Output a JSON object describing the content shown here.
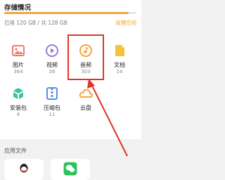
{
  "storage": {
    "title": "存储情况",
    "used_text": "已用 120 GB / 共 128 GB",
    "clean_label": "清理空间",
    "used_fraction": 0.94,
    "accent_color": "#f3a63b"
  },
  "categories": [
    {
      "label": "图片",
      "count": "364",
      "icon": "image-icon",
      "color": "#f07a6a"
    },
    {
      "label": "视频",
      "count": "36",
      "icon": "video-play-icon",
      "color": "#9b7bd8"
    },
    {
      "label": "音频",
      "count": "303",
      "icon": "music-icon",
      "color": "#f3a63b"
    },
    {
      "label": "文档",
      "count": "14",
      "icon": "document-icon",
      "color": "#f5c23e"
    },
    {
      "label": "安装包",
      "count": "4",
      "icon": "package-icon",
      "color": "#3cc3a0"
    },
    {
      "label": "压缩包",
      "count": "11",
      "icon": "archive-icon",
      "color": "#5b8def"
    },
    {
      "label": "云盘",
      "count": "",
      "icon": "cloud-icon",
      "color": "#f3a63b"
    }
  ],
  "apps": {
    "title": "应用文件",
    "items": [
      {
        "label": "QQ",
        "icon": "qq-icon"
      },
      {
        "label": "微信",
        "icon": "wechat-icon",
        "color": "#2fc25b"
      }
    ]
  },
  "highlight_color": "#e3322b"
}
